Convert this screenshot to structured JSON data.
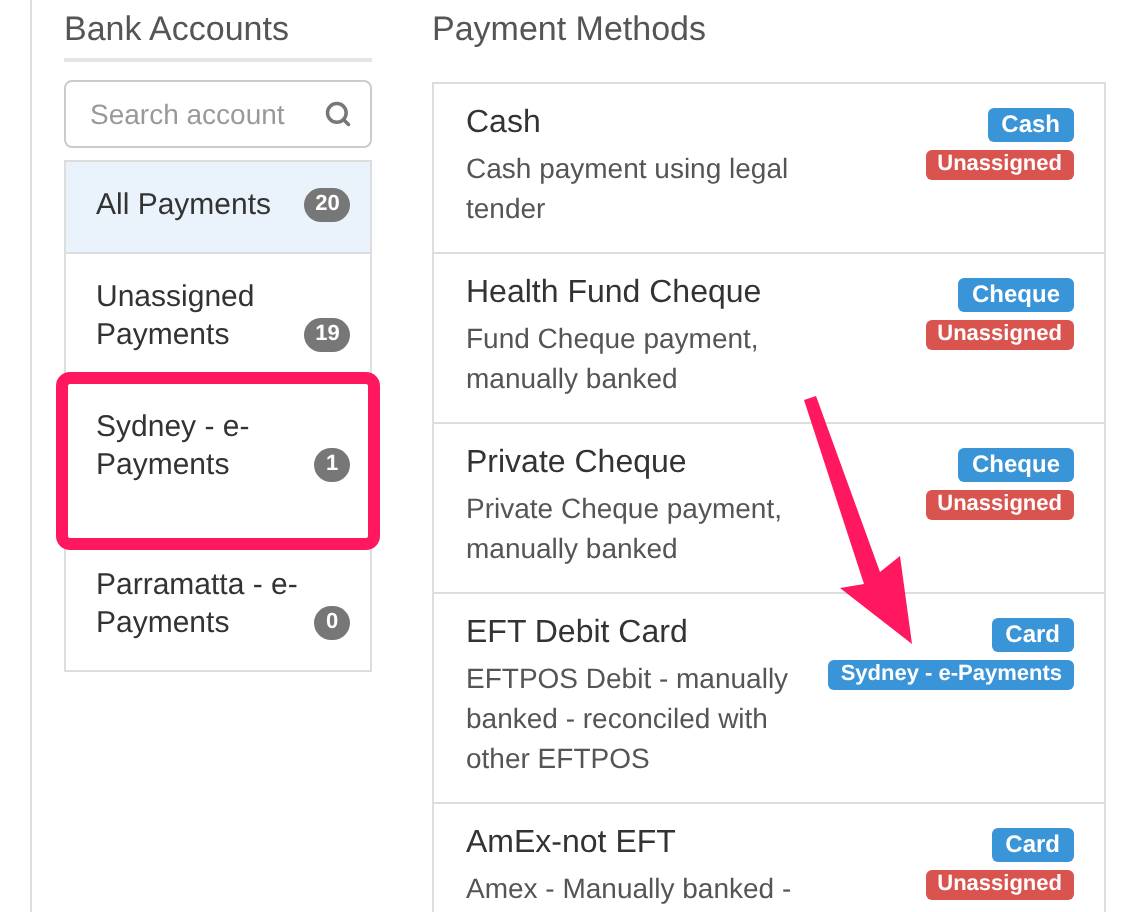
{
  "bank_accounts": {
    "title": "Bank Accounts",
    "search": {
      "placeholder": "Search account"
    },
    "items": [
      {
        "name": "All Payments",
        "count": "20",
        "selected": true,
        "highlighted": false
      },
      {
        "name": "Unassigned Payments",
        "count": "19",
        "selected": false,
        "highlighted": false
      },
      {
        "name": "Sydney - e-Payments",
        "count": "1",
        "selected": false,
        "highlighted": true
      },
      {
        "name": "Parramatta - e-Payments",
        "count": "0",
        "selected": false,
        "highlighted": false
      }
    ]
  },
  "payment_methods": {
    "title": "Payment Methods",
    "items": [
      {
        "name": "Cash",
        "description": "Cash payment using legal tender",
        "type": "Cash",
        "account": "Unassigned",
        "assigned": false
      },
      {
        "name": "Health Fund Cheque",
        "description": "Fund Cheque payment, manually banked",
        "type": "Cheque",
        "account": "Unassigned",
        "assigned": false
      },
      {
        "name": "Private Cheque",
        "description": "Private Cheque payment, manually banked",
        "type": "Cheque",
        "account": "Unassigned",
        "assigned": false
      },
      {
        "name": "EFT Debit Card",
        "description": "EFTPOS Debit - manually banked - reconciled with other EFTPOS",
        "type": "Card",
        "account": "Sydney - e-Payments",
        "assigned": true
      },
      {
        "name": "AmEx-not EFT",
        "description": "Amex - Manually banked -",
        "type": "Card",
        "account": "Unassigned",
        "assigned": false
      }
    ]
  }
}
